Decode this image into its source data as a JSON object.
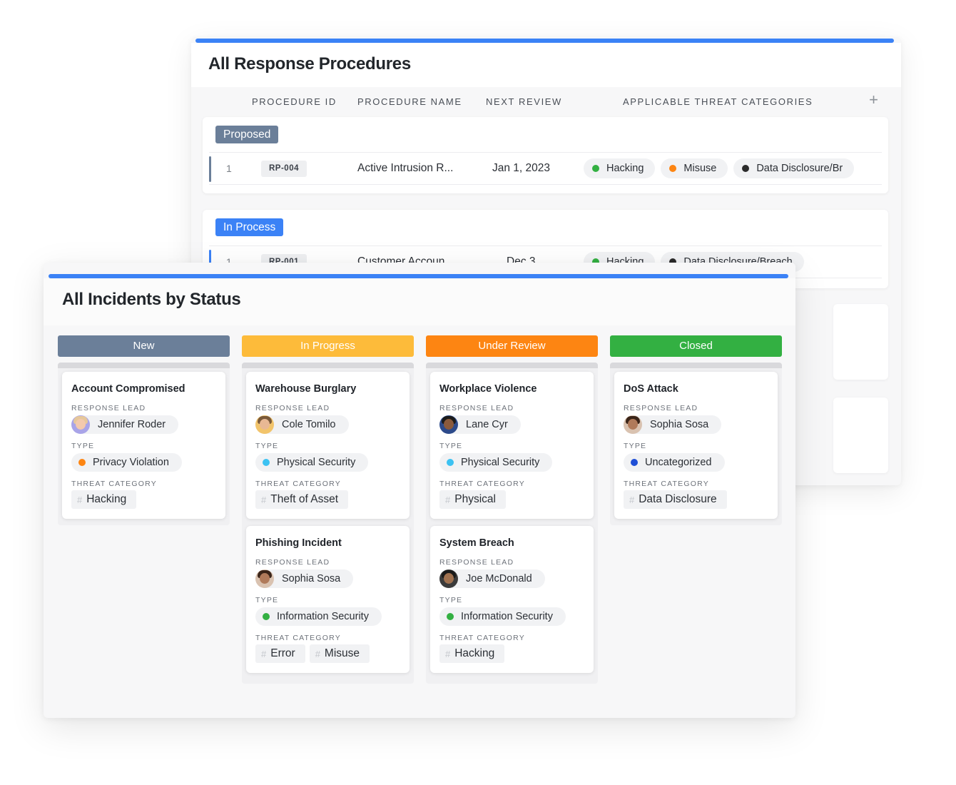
{
  "colors": {
    "accent_blue": "#3b82f6",
    "proposed": "#6b7f99",
    "in_process": "#3b82f6",
    "new": "#6b7f99",
    "in_progress": "#fdbb3a",
    "under_review": "#fd8512",
    "closed": "#33b042",
    "green": "#33b042",
    "orange": "#fd8512",
    "dark": "#2b2b2b",
    "cyan": "#3cc2f2",
    "navy": "#1f4fd6"
  },
  "procedures": {
    "title": "All Response Procedures",
    "columns": [
      "PROCEDURE ID",
      "PROCEDURE NAME",
      "NEXT REVIEW",
      "APPLICABLE THREAT CATEGORIES"
    ],
    "add_icon": "plus-icon",
    "groups": [
      {
        "label": "Proposed",
        "row": {
          "num": "1",
          "id": "RP-004",
          "name": "Active Intrusion R...",
          "date": "Jan 1, 2023",
          "categories": [
            {
              "label": "Hacking",
              "color": "#33b042"
            },
            {
              "label": "Misuse",
              "color": "#fd8512"
            },
            {
              "label": "Data Disclosure/Br",
              "color": "#2b2b2b"
            }
          ]
        }
      },
      {
        "label": "In Process",
        "row": {
          "num": "1",
          "id": "RP-001",
          "name": "Customer Accoun...",
          "date": "Dec 3",
          "categories": [
            {
              "label": "Hacking",
              "color": "#33b042"
            },
            {
              "label": "Data Disclosure/Breach",
              "color": "#2b2b2b"
            }
          ]
        }
      }
    ]
  },
  "incidents": {
    "title": "All Incidents by Status",
    "labels": {
      "lead": "RESPONSE LEAD",
      "type": "TYPE",
      "threat": "THREAT CATEGORY"
    },
    "columns": [
      {
        "status": "New",
        "cards": [
          {
            "title": "Account Compromised",
            "lead": "Jennifer Roder",
            "type": "Privacy Violation",
            "type_color": "#fd8512",
            "threats": [
              "Hacking"
            ]
          }
        ]
      },
      {
        "status": "In Progress",
        "cards": [
          {
            "title": "Warehouse Burglary",
            "lead": "Cole Tomilo",
            "type": "Physical Security",
            "type_color": "#3cc2f2",
            "threats": [
              "Theft of Asset"
            ]
          },
          {
            "title": "Phishing Incident",
            "lead": "Sophia Sosa",
            "type": "Information Security",
            "type_color": "#33b042",
            "threats": [
              "Error",
              "Misuse"
            ]
          }
        ]
      },
      {
        "status": "Under Review",
        "cards": [
          {
            "title": "Workplace Violence",
            "lead": "Lane Cyr",
            "type": "Physical Security",
            "type_color": "#3cc2f2",
            "threats": [
              "Physical"
            ]
          },
          {
            "title": "System Breach",
            "lead": "Joe McDonald",
            "type": "Information Security",
            "type_color": "#33b042",
            "threats": [
              "Hacking"
            ]
          }
        ]
      },
      {
        "status": "Closed",
        "cards": [
          {
            "title": "DoS Attack",
            "lead": "Sophia Sosa",
            "type": "Uncategorized",
            "type_color": "#1f4fd6",
            "threats": [
              "Data Disclosure"
            ]
          }
        ]
      }
    ]
  }
}
